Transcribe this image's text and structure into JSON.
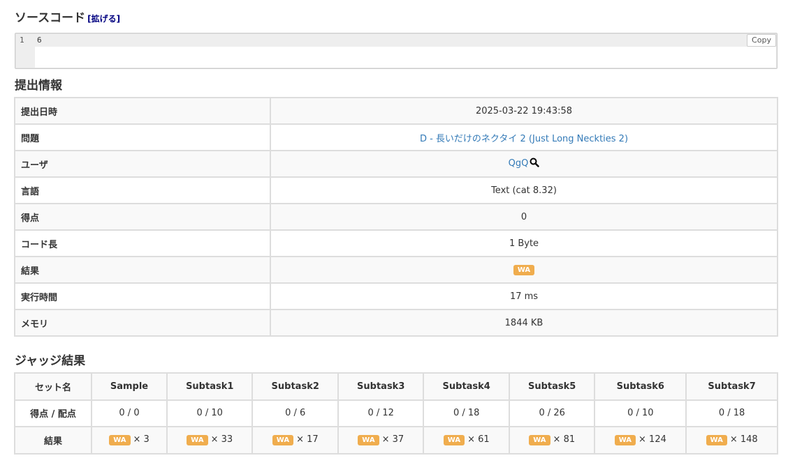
{
  "source": {
    "heading": "ソースコード",
    "expand_link": "[拡げる]",
    "line_number": "1",
    "code": "6",
    "copy_label": "Copy"
  },
  "submission": {
    "heading": "提出情報",
    "rows": [
      {
        "label": "提出日時",
        "value": "2025-03-22 19:43:58"
      },
      {
        "label": "問題",
        "value": "D - 長いだけのネクタイ 2 (Just Long Neckties 2)"
      },
      {
        "label": "ユーザ",
        "value": "QgQ"
      },
      {
        "label": "言語",
        "value": "Text (cat 8.32)"
      },
      {
        "label": "得点",
        "value": "0"
      },
      {
        "label": "コード長",
        "value": "1 Byte"
      },
      {
        "label": "結果",
        "value": "WA"
      },
      {
        "label": "実行時間",
        "value": "17 ms"
      },
      {
        "label": "メモリ",
        "value": "1844 KB"
      }
    ]
  },
  "judge": {
    "heading": "ジャッジ結果",
    "row_labels": [
      "セット名",
      "得点 / 配点",
      "結果"
    ],
    "sets": [
      {
        "name": "Sample",
        "score": "0 / 0",
        "status": "WA",
        "count": "× 3"
      },
      {
        "name": "Subtask1",
        "score": "0 / 10",
        "status": "WA",
        "count": "× 33"
      },
      {
        "name": "Subtask2",
        "score": "0 / 6",
        "status": "WA",
        "count": "× 17"
      },
      {
        "name": "Subtask3",
        "score": "0 / 12",
        "status": "WA",
        "count": "× 37"
      },
      {
        "name": "Subtask4",
        "score": "0 / 18",
        "status": "WA",
        "count": "× 61"
      },
      {
        "name": "Subtask5",
        "score": "0 / 26",
        "status": "WA",
        "count": "× 81"
      },
      {
        "name": "Subtask6",
        "score": "0 / 10",
        "status": "WA",
        "count": "× 124"
      },
      {
        "name": "Subtask7",
        "score": "0 / 18",
        "status": "WA",
        "count": "× 148"
      }
    ]
  },
  "colors": {
    "link": "#337ab7",
    "wa_badge": "#f0ad4e",
    "expand_link": "#000080"
  },
  "icons": {
    "user_search": "search-icon"
  }
}
